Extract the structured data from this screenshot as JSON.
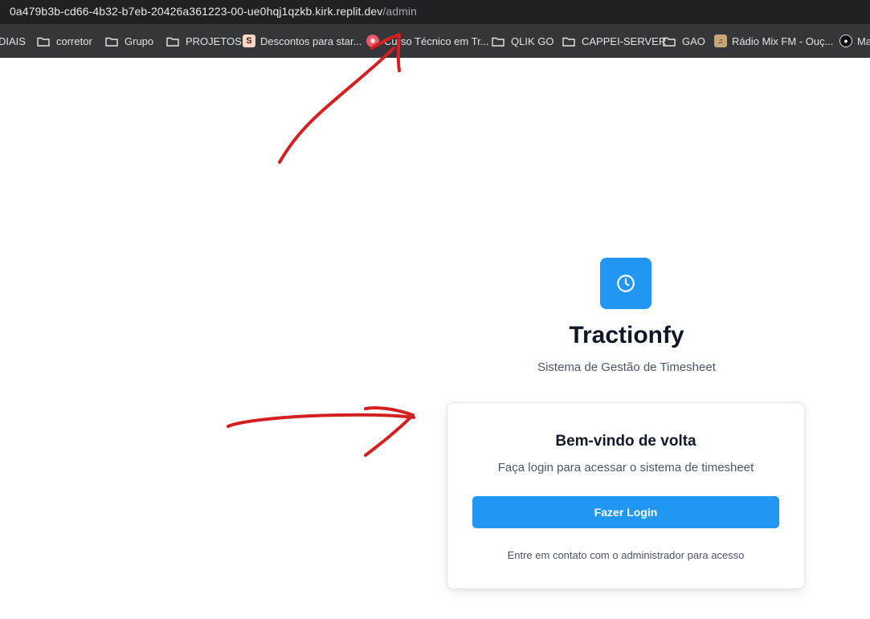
{
  "browser": {
    "url_host": "0a479b3b-cd66-4b32-b7eb-20426a361223-00-ue0hqj1qzkb.kirk.replit.dev",
    "url_path": "/admin",
    "bookmarks": [
      {
        "label": "DIAIS",
        "icon": "none"
      },
      {
        "label": "corretor",
        "icon": "folder-icon"
      },
      {
        "label": "Grupo",
        "icon": "folder-icon"
      },
      {
        "label": "PROJETOS",
        "icon": "folder-icon"
      },
      {
        "label": "Descontos para star...",
        "icon": "s-favicon",
        "glyph": "S"
      },
      {
        "label": "Curso Técnico em Tr...",
        "icon": "red-round-favicon"
      },
      {
        "label": "QLIK GO",
        "icon": "folder-icon"
      },
      {
        "label": "CAPPEI-SERVER",
        "icon": "folder-icon"
      },
      {
        "label": "GAO",
        "icon": "folder-icon"
      },
      {
        "label": "Rádio Mix FM - Ouç...",
        "icon": "radio-favicon"
      },
      {
        "label": "Ma",
        "icon": "dark-round-favicon"
      }
    ]
  },
  "app": {
    "name": "Tractionfy",
    "tagline": "Sistema de Gestão de Timesheet",
    "logo_icon": "clock-icon",
    "accent_color": "#2196f3"
  },
  "login_card": {
    "title": "Bem-vindo de volta",
    "subtitle": "Faça login para acessar o sistema de timesheet",
    "button_label": "Fazer Login",
    "note": "Entre em contato com o administrador para acesso"
  },
  "annotations": {
    "color": "#d42020",
    "items": [
      "red-arrow-to-url-path",
      "red-arrow-to-login-card"
    ]
  }
}
